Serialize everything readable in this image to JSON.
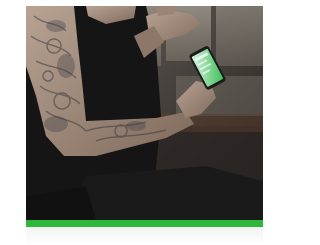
{
  "card": {
    "image": {
      "subject": "tattooed-man-using-smartphone",
      "icon": "photo"
    },
    "accent_color": "#2db83d",
    "phone_screen_color": "#3fbf5a"
  }
}
